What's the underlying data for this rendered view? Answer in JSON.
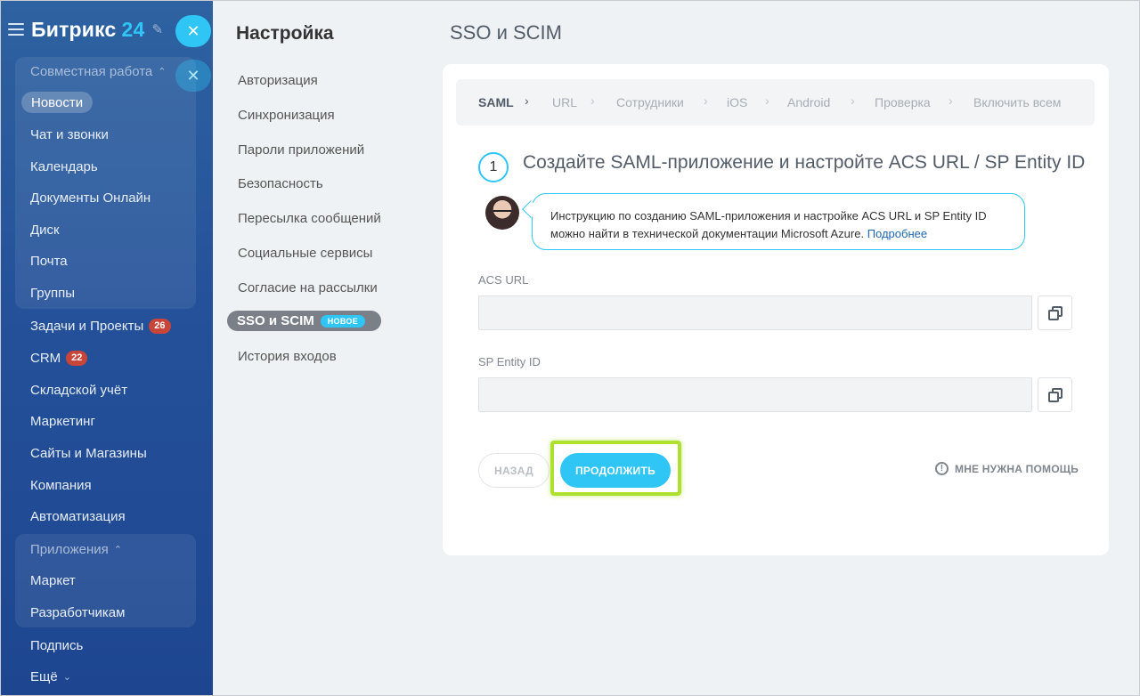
{
  "app": {
    "logo_name": "Битрикс",
    "logo_number": "24"
  },
  "sidebar": {
    "groups": {
      "collab": "Совместная работа",
      "apps": "Приложения"
    },
    "items": [
      {
        "label": "Новости",
        "active": true
      },
      {
        "label": "Чат и звонки"
      },
      {
        "label": "Календарь"
      },
      {
        "label": "Документы Онлайн"
      },
      {
        "label": "Диск"
      },
      {
        "label": "Почта"
      },
      {
        "label": "Группы"
      },
      {
        "label": "Задачи и Проекты",
        "counter": "26"
      },
      {
        "label": "CRM",
        "counter": "22"
      },
      {
        "label": "Складской учёт"
      },
      {
        "label": "Маркетинг"
      },
      {
        "label": "Сайты и Магазины"
      },
      {
        "label": "Компания"
      },
      {
        "label": "Автоматизация"
      },
      {
        "label": "Маркет"
      },
      {
        "label": "Разработчикам"
      },
      {
        "label": "Подпись"
      },
      {
        "label": "Ещё"
      }
    ],
    "colors": {
      "counter": "#c8453a",
      "accent": "#2fc6f6"
    }
  },
  "settings": {
    "title": "Настройка",
    "nav": [
      "Авторизация",
      "Синхронизация",
      "Пароли приложений",
      "Безопасность",
      "Пересылка сообщений",
      "Социальные сервисы",
      "Согласие на рассылки",
      "SSO и SCIM",
      "История входов"
    ],
    "active_badge": "НОВОЕ"
  },
  "main": {
    "title": "SSO и SCIM",
    "steps": [
      "SAML",
      "URL",
      "Сотрудники",
      "iOS",
      "Android",
      "Проверка",
      "Включить всем"
    ],
    "step_number": "1",
    "step_heading": "Создайте SAML-приложение и настройте ACS URL / SP Entity ID",
    "hint_text": "Инструкцию по созданию SAML-приложения и настройке ACS URL и SP Entity ID можно найти в технической документации Microsoft Azure.",
    "hint_link": "Подробнее",
    "fields": {
      "acs_label": "ACS URL",
      "acs_value": "",
      "sp_label": "SP Entity ID",
      "sp_value": ""
    },
    "buttons": {
      "back": "НАЗАД",
      "continue": "ПРОДОЛЖИТЬ",
      "help": "МНЕ НУЖНА ПОМОЩЬ"
    },
    "colors": {
      "primary": "#2fc6f6",
      "highlight": "#aee030"
    }
  }
}
